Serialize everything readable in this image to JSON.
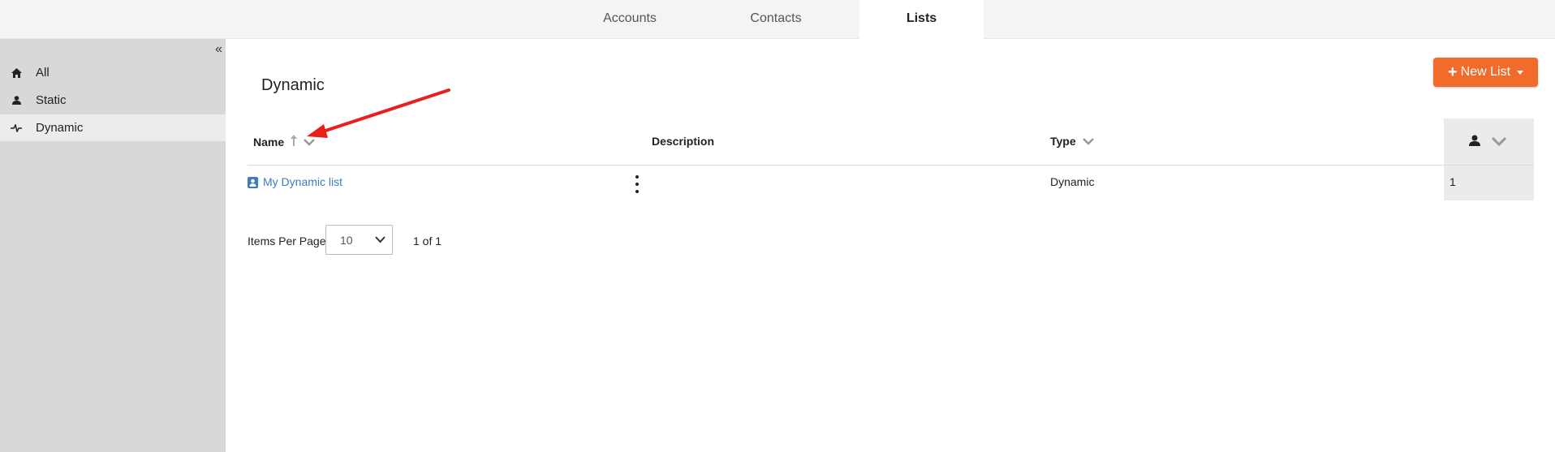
{
  "tabs": [
    {
      "label": "Accounts"
    },
    {
      "label": "Contacts"
    },
    {
      "label": "Lists"
    }
  ],
  "sidebar": {
    "items": [
      {
        "label": "All",
        "icon": "home-icon"
      },
      {
        "label": "Static",
        "icon": "person-icon"
      },
      {
        "label": "Dynamic",
        "icon": "pulse-icon"
      }
    ]
  },
  "main": {
    "heading": "Dynamic",
    "new_button": "New List",
    "columns": {
      "name": "Name",
      "description": "Description",
      "type": "Type"
    },
    "rows": [
      {
        "name": "My Dynamic list",
        "description": "",
        "type": "Dynamic",
        "count": "1"
      }
    ],
    "pagination": {
      "items_per_page_label": "Items Per Page",
      "items_per_page": "10",
      "page_info": "1 of 1"
    }
  },
  "colors": {
    "accent": "#f26b2b",
    "link": "#3b7bc0",
    "annotation_arrow": "#e8201c"
  }
}
